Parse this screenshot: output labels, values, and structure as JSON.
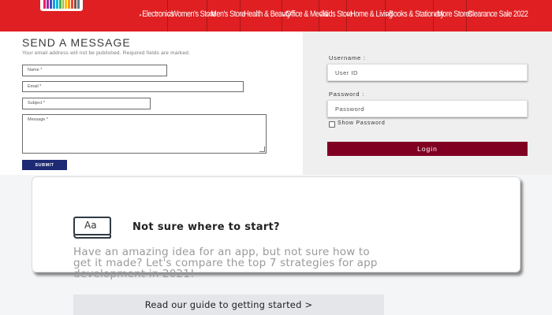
{
  "nav": {
    "items": [
      "Electronics",
      "Women's Store",
      "Men's Store",
      "Health & Beauty",
      "Office & Media",
      "Kids Store",
      "Home & Living",
      "Books & Stationery",
      "More Stores",
      "Clearance Sale 2022"
    ],
    "logo_colors": [
      "#e91e63",
      "#9c27b0",
      "#3f51b5",
      "#2196f3",
      "#00bcd4",
      "#4caf50",
      "#8bc34a",
      "#ffc107",
      "#ff9800",
      "#f44336",
      "#795548",
      "#607d8b"
    ]
  },
  "contact": {
    "title": "SEND A MESSAGE",
    "note": "Your email address will not be published. Required fields are marked.",
    "name_label": "Name *",
    "email_label": "Email *",
    "subject_label": "Subject *",
    "message_label": "Message *",
    "submit_label": "SUBMIT"
  },
  "login": {
    "username_label": "Username :",
    "username_placeholder": "User ID",
    "password_label": "Password :",
    "password_placeholder": "Password",
    "show_password_label": "Show Password",
    "login_button": "Login"
  },
  "card": {
    "icon_text": "Aa",
    "title": "Not sure where to start?",
    "body_line1": "Have an amazing idea for an app, but not sure how to",
    "body_line2": "get it made? Let's compare the top 7 strategies for app",
    "body_line3": "development in 2021!",
    "guide_button": "Read our guide to getting started >"
  },
  "colors": {
    "nav_red": "#e01f22",
    "submit_blue": "#1d2a73",
    "login_maroon": "#800022"
  }
}
